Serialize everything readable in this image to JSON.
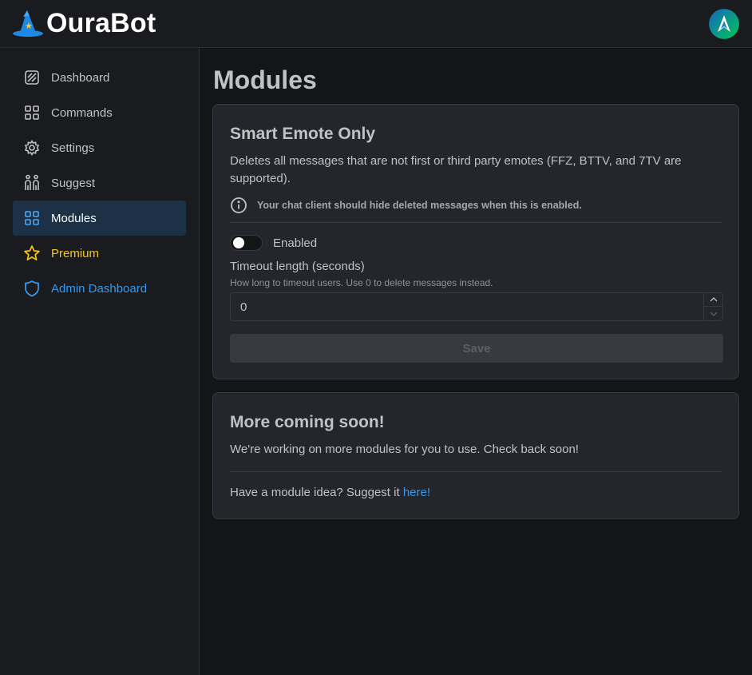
{
  "app": {
    "name": "OuraBot"
  },
  "sidebar": {
    "items": [
      {
        "label": "Dashboard",
        "icon": "dashboard-icon",
        "state": "default"
      },
      {
        "label": "Commands",
        "icon": "commands-grid-icon",
        "state": "default"
      },
      {
        "label": "Settings",
        "icon": "gear-icon",
        "state": "default"
      },
      {
        "label": "Suggest",
        "icon": "people-icon",
        "state": "default"
      },
      {
        "label": "Modules",
        "icon": "modules-grid-icon",
        "state": "active"
      },
      {
        "label": "Premium",
        "icon": "star-icon",
        "state": "premium"
      },
      {
        "label": "Admin Dashboard",
        "icon": "shield-icon",
        "state": "admin"
      }
    ]
  },
  "main": {
    "title": "Modules",
    "smart_emote": {
      "title": "Smart Emote Only",
      "description": "Deletes all messages that are not first or third party emotes (FFZ, BTTV, and 7TV are supported).",
      "info": "Your chat client should hide deleted messages when this is enabled.",
      "toggle_label": "Enabled",
      "toggle_on": false,
      "timeout_label": "Timeout length (seconds)",
      "timeout_desc": "How long to timeout users. Use 0 to delete messages instead.",
      "timeout_value": "0",
      "save_label": "Save"
    },
    "coming_soon": {
      "title": "More coming soon!",
      "description": "We're working on more modules for you to use. Check back soon!",
      "idea_text": "Have a module idea? Suggest it ",
      "idea_link": "here!"
    }
  },
  "colors": {
    "background": "#141517",
    "card": "#25262b",
    "active_nav": "#1c3046",
    "premium": "#fcc419",
    "admin": "#339af0",
    "link": "#339af0"
  }
}
